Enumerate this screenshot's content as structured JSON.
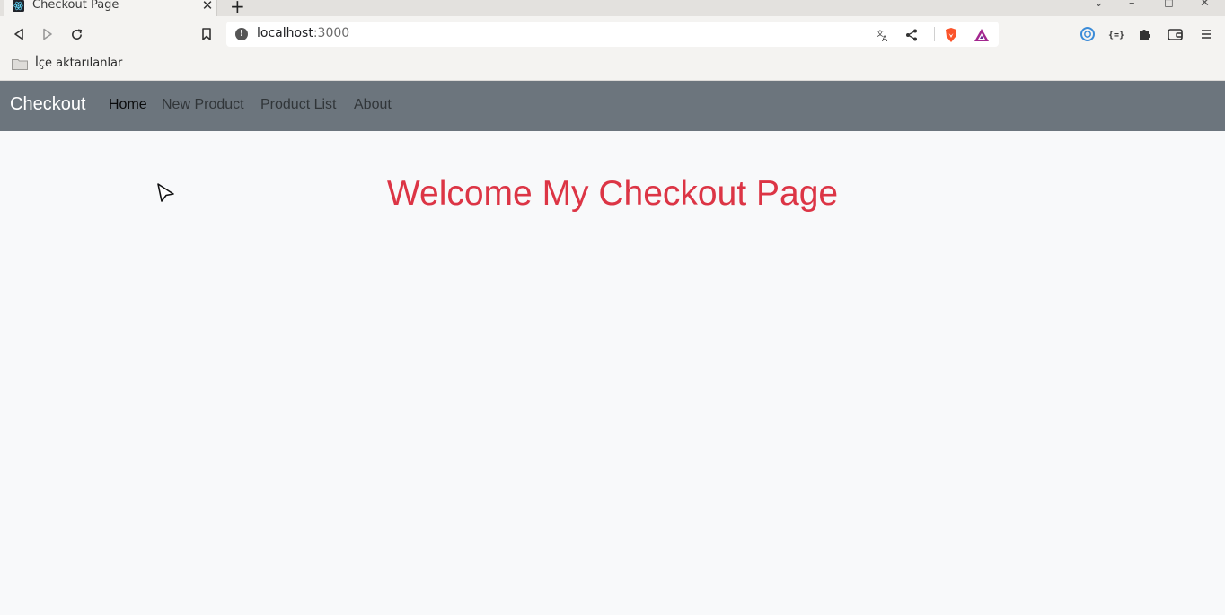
{
  "browser": {
    "tab": {
      "title": "Checkout Page",
      "favicon": "react-icon",
      "close_icon": "close-icon"
    },
    "new_tab_label": "+",
    "window_controls": {
      "dropdown": "⌄",
      "minimize": "–",
      "maximize": "◻",
      "close": "✕"
    },
    "toolbar": {
      "back_icon": "back-arrow-icon",
      "forward_icon": "forward-arrow-icon",
      "reload_icon": "reload-icon",
      "bookmark_icon": "bookmark-icon"
    },
    "url": {
      "host": "localhost",
      "port": ":3000",
      "info_icon": "!"
    },
    "bookmarks_bar": {
      "folder_label": "İçe aktarılanlar"
    },
    "colors": {
      "brave_orange": "#fb542b",
      "rewards_purple": "#662d91"
    }
  },
  "page": {
    "navbar": {
      "brand": "Checkout",
      "links": [
        {
          "label": "Home",
          "active": true
        },
        {
          "label": "New Product",
          "active": false
        },
        {
          "label": "Product List",
          "active": false
        },
        {
          "label": "About",
          "active": false
        }
      ]
    },
    "heading": "Welcome My Checkout Page",
    "colors": {
      "navbar_bg": "#6c757d",
      "heading": "#dc3545",
      "body_bg": "#f8f9fa"
    }
  }
}
